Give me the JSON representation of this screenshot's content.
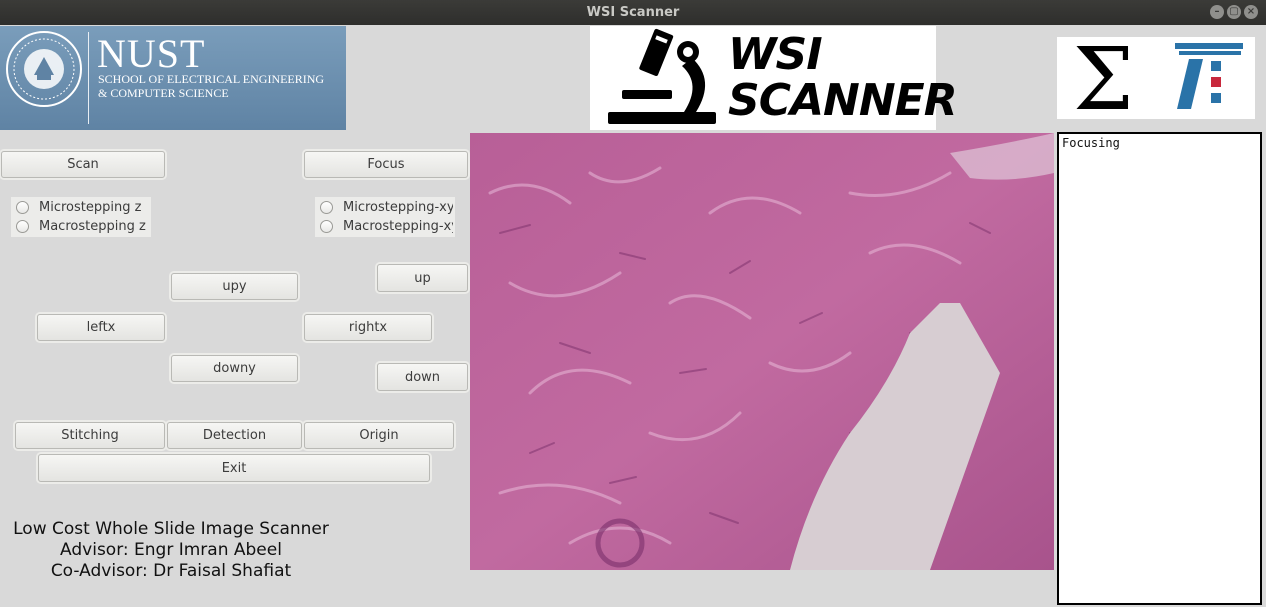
{
  "window": {
    "title": "WSI Scanner"
  },
  "logos": {
    "nust_name": "NUST",
    "nust_subtitle_line1": "SCHOOL OF ELECTRICAL ENGINEERING",
    "nust_subtitle_line2": "& COMPUTER SCIENCE",
    "wsi_line1": "WSI",
    "wsi_line2": "SCANNER",
    "colors": {
      "nust_blue": "#6a8fb0",
      "sigma_blue": "#2a73a8",
      "sigma_red": "#c8283c"
    }
  },
  "controls": {
    "scan": "Scan",
    "focus": "Focus",
    "micro_z": "Microstepping z",
    "macro_z": "Macrostepping z",
    "micro_xy": "Microstepping-xy",
    "macro_xy": "Macrostepping-xy",
    "upy": "upy",
    "up": "up",
    "leftx": "leftx",
    "rightx": "rightx",
    "downy": "downy",
    "down": "down",
    "stitching": "Stitching",
    "detection": "Detection",
    "origin": "Origin",
    "exit": "Exit"
  },
  "credits": {
    "line1": "Low Cost Whole Slide Image Scanner",
    "line2": "Advisor: Engr Imran Abeel",
    "line3": "Co-Advisor: Dr Faisal Shafiat"
  },
  "log": {
    "text": "Focusing"
  },
  "icons": [
    "minimize-icon",
    "maximize-icon",
    "close-icon",
    "nust-seal-icon",
    "microscope-icon",
    "sigma-icon"
  ]
}
